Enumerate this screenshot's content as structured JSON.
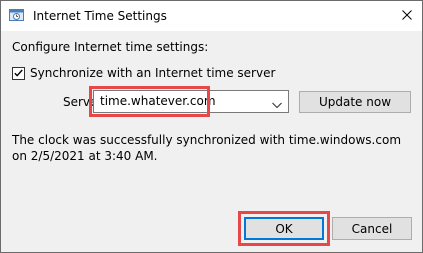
{
  "window": {
    "title": "Internet Time Settings",
    "icon": "clock-settings-icon",
    "close_icon": "close-icon"
  },
  "settings": {
    "group_heading": "Configure Internet time settings:",
    "sync_label": "Synchronize with an Internet time server",
    "sync_checked": true,
    "server_label": "Server:",
    "server_value": "time.whatever.com",
    "update_button": "Update now"
  },
  "status": {
    "message": "The clock was successfully synchronized with time.windows.com on 2/5/2021 at 3:40 AM."
  },
  "footer": {
    "ok_button": "OK",
    "cancel_button": "Cancel"
  },
  "colors": {
    "highlight": "#e8474a",
    "focus_border": "#0078d7",
    "dialog_bg": "#f0f0f0"
  }
}
